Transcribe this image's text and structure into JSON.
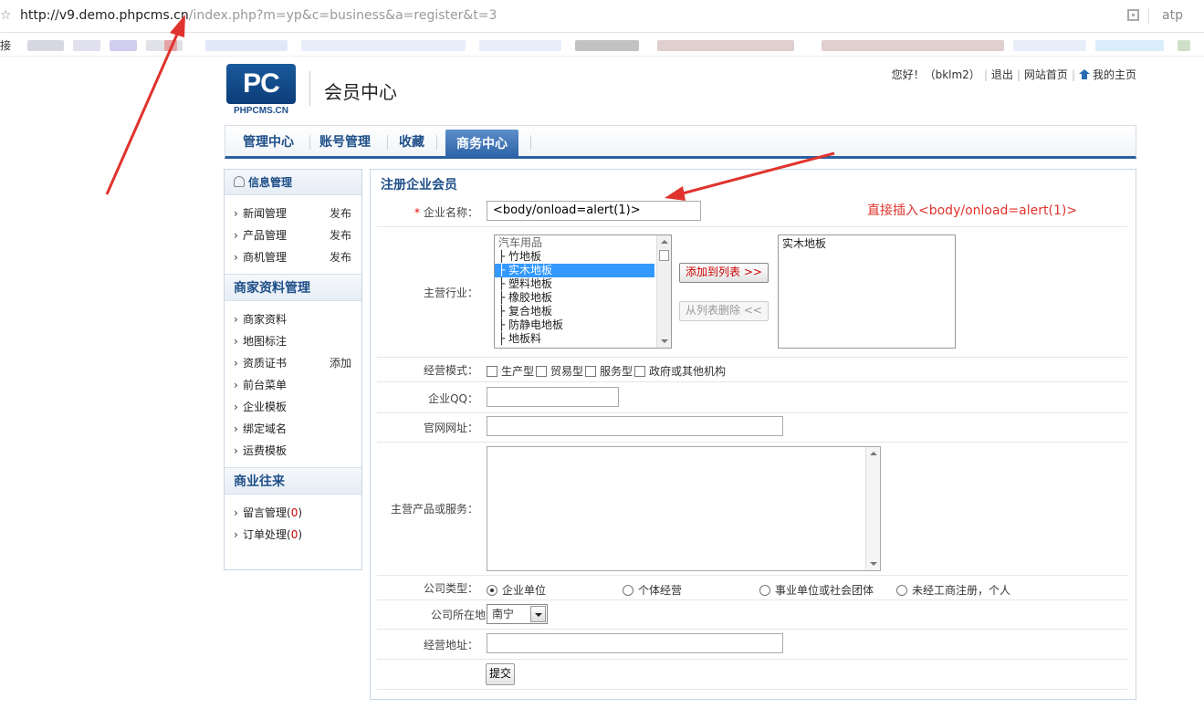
{
  "browser": {
    "url_host": "http://v9.demo.phpcms.cn",
    "url_path": "/index.php?m=yp&c=business&a=register&t=3",
    "profile": "atp",
    "bookmarks_label": "链接"
  },
  "header": {
    "logo_text": "PC",
    "logo_sub": "PHPCMS.CN",
    "title": "会员中心",
    "greeting": "您好！（bklm2）",
    "logout": "退出",
    "site_home": "网站首页",
    "my_home": "我的主页"
  },
  "nav": {
    "tabs": [
      "管理中心",
      "账号管理",
      "收藏",
      "商务中心"
    ],
    "active": "商务中心"
  },
  "sidebar": {
    "section1": {
      "title": "信息管理",
      "items": [
        {
          "label": "新闻管理",
          "action": "发布"
        },
        {
          "label": "产品管理",
          "action": "发布"
        },
        {
          "label": "商机管理",
          "action": "发布"
        }
      ]
    },
    "section2": {
      "title": "商家资料管理",
      "items": [
        {
          "label": "商家资料",
          "action": ""
        },
        {
          "label": "地图标注",
          "action": ""
        },
        {
          "label": "资质证书",
          "action": "添加"
        },
        {
          "label": "前台菜单",
          "action": ""
        },
        {
          "label": "企业模板",
          "action": ""
        },
        {
          "label": "绑定域名",
          "action": ""
        },
        {
          "label": "运费模板",
          "action": ""
        }
      ]
    },
    "section3": {
      "title": "商业往来",
      "items": [
        {
          "label": "留言管理",
          "count": "0"
        },
        {
          "label": "订单处理",
          "count": "0"
        }
      ]
    }
  },
  "form": {
    "title": "注册企业会员",
    "company_name_label": "企业名称：",
    "company_name_value": "<body/onload=alert(1)>",
    "annotation": "直接插入<body/onload=alert(1)>",
    "industry_label": "主营行业：",
    "industry_options": [
      {
        "text": "汽车用品",
        "type": "group"
      },
      {
        "text": "├ 竹地板",
        "type": "item"
      },
      {
        "text": "├ 实木地板",
        "type": "selected"
      },
      {
        "text": "├ 塑料地板",
        "type": "item"
      },
      {
        "text": "├ 橡胶地板",
        "type": "item"
      },
      {
        "text": "├ 复合地板",
        "type": "item"
      },
      {
        "text": "├ 防静电地板",
        "type": "item"
      },
      {
        "text": "├ 地板料",
        "type": "item"
      }
    ],
    "add_button": "添加到列表 >>",
    "remove_button": "从列表删除 <<",
    "selected_industries": [
      "实木地板"
    ],
    "mode_label": "经营模式：",
    "mode_options": [
      "生产型",
      "贸易型",
      "服务型",
      "政府或其他机构"
    ],
    "qq_label": "企业QQ：",
    "website_label": "官网网址：",
    "products_label": "主营产品或服务：",
    "company_type_label": "公司类型：",
    "company_types": [
      "企业单位",
      "个体经营",
      "事业单位或社会团体",
      "未经工商注册，个人"
    ],
    "company_type_selected": "企业单位",
    "location_label": "公司所在地：",
    "location_value": "南宁",
    "address_label": "经营地址：",
    "submit": "提交"
  },
  "colors": {
    "nav_blue": "#2a5fa0",
    "link_blue": "#1e4f88",
    "annotation_red": "#e0332e",
    "selected_blue": "#3399ff"
  }
}
